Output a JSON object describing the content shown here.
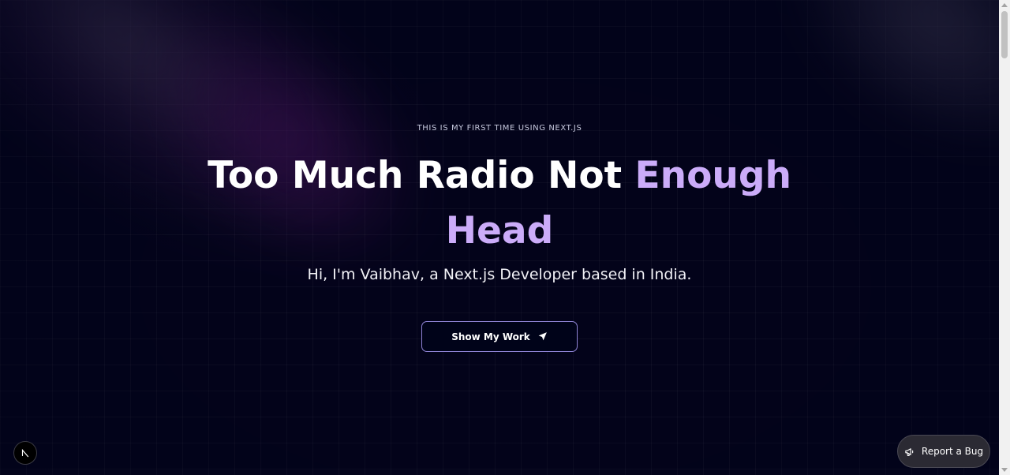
{
  "hero": {
    "eyebrow": "THIS IS MY FIRST TIME USING NEXT.JS",
    "headline_main": "Too Much Radio Not ",
    "headline_accent": "Enough Head",
    "subtitle": "Hi, I'm Vaibhav, a Next.js Developer based in India.",
    "cta_label": "Show My Work"
  },
  "widgets": {
    "report_bug_label": "Report a Bug"
  },
  "icons": {
    "cta": "navigation-arrow-icon",
    "next": "nextjs-logo-icon",
    "report": "megaphone-icon"
  },
  "colors": {
    "background": "#000319",
    "accent": "#cbacf9",
    "button_border": "#8f84d6"
  }
}
